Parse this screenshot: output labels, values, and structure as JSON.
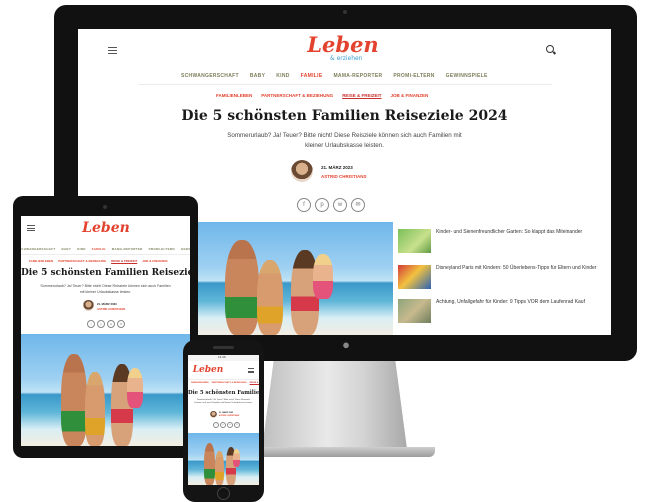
{
  "site": {
    "logo": "Leben",
    "logo_sub": "& erziehen",
    "nav": [
      "SCHWANGERSCHAFT",
      "BABY",
      "KIND",
      "FAMILIE",
      "MAMA-REPORTER",
      "PROMI-ELTERN",
      "GEWINNSPIELE"
    ],
    "nav_active": "FAMILIE",
    "subnav": [
      "FAMILIENLEBEN",
      "PARTNERSCHAFT & BEZIEHUNG",
      "REISE & FREIZEIT",
      "JOB & FINANZEN"
    ],
    "subnav_active": "REISE & FREIZEIT"
  },
  "article": {
    "title": "Die 5 schönsten Familien Reiseziele 2024",
    "lead": "Sommerurlaub? Ja! Teuer? Bitte nicht! Diese Reisziele können sich auch Familien mit kleiner Urlaubskasse leisten.",
    "date": "21. MÄRZ 2023",
    "author": "ASTRID CHRISTIANS",
    "share_icons": [
      "facebook-icon",
      "pinterest-icon",
      "whatsapp-icon",
      "email-icon"
    ]
  },
  "sidebar": [
    {
      "text": "Kinder- und Sienenfreundlicher Garten: So klappt das Miteinander"
    },
    {
      "text": "Disneyland Paris mit Kindern: 50 Überlebens-Tipps für Eltern und Kinder"
    },
    {
      "text": "Achtung, Unfallgefahr für Kinder: 9 Tipps VOR dem Laufenrad Kauf"
    }
  ],
  "phone": {
    "title": "Die 5 schönsten Familien",
    "status_time": "12:49"
  },
  "colors": {
    "brand": "#e3432e",
    "nav_text": "#7d7d5a",
    "device_frame": "#111111"
  }
}
